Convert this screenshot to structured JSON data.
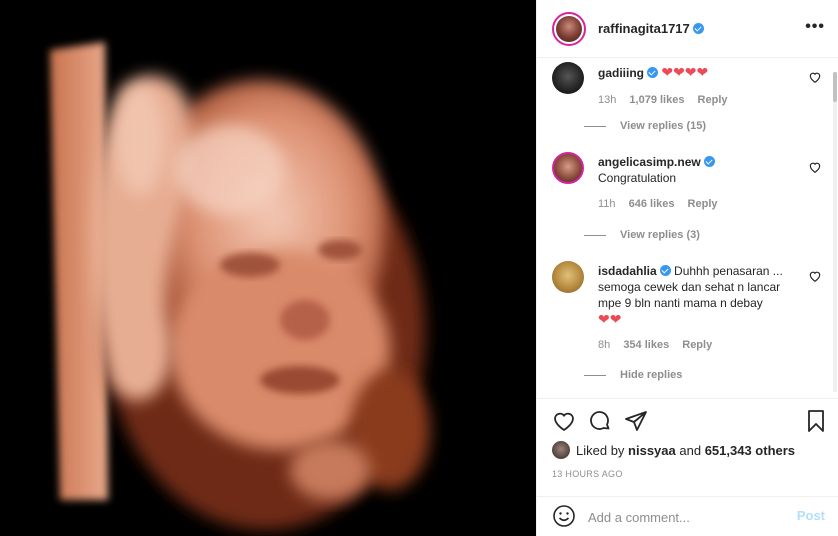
{
  "post": {
    "username": "raffinagita1717",
    "verified": true
  },
  "comments": [
    {
      "username": "gadiiing",
      "verified": true,
      "text": "❤❤❤❤",
      "time": "13h",
      "likes": "1,079 likes",
      "reply": "Reply",
      "replies": "View replies (15)"
    },
    {
      "username": "angelicasimp.new",
      "verified": true,
      "text": "Congratulation",
      "time": "11h",
      "likes": "646 likes",
      "reply": "Reply",
      "replies": "View replies (3)"
    },
    {
      "username": "isdadahlia",
      "verified": true,
      "text": "Duhhh penasaran ... semoga cewek dan sehat n lancar mpe 9 bln nanti mama n debay",
      "hearts": "❤❤",
      "time": "8h",
      "likes": "354 likes",
      "reply": "Reply",
      "replies": "Hide replies"
    }
  ],
  "likes": {
    "prefix": "Liked by",
    "user": "nissyaa",
    "and": "and",
    "count": "651,343 others"
  },
  "time_ago": "13 HOURS AGO",
  "add_comment": {
    "placeholder": "Add a comment...",
    "post_label": "Post"
  },
  "colors": {
    "accent": "#3897f0",
    "heart": "#ed4956",
    "post_disabled": "#b2dffc"
  }
}
